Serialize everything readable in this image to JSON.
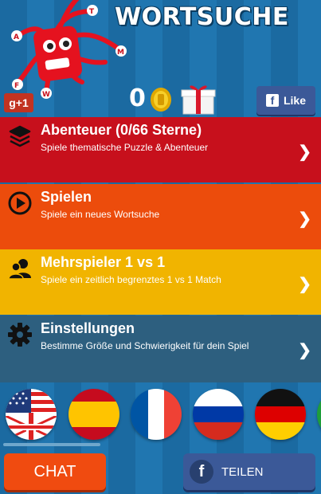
{
  "header": {
    "title": "WORTSUCHE",
    "gplus_label": "g+1",
    "coin_count": "0",
    "fb_like_label": "Like",
    "mascot_letters": [
      "T",
      "A",
      "M",
      "F",
      "W"
    ]
  },
  "menu": [
    {
      "title": "Abenteuer (0/66 Sterne)",
      "subtitle": "Spiele thematische Puzzle & Abenteuer",
      "icon": "layers-icon"
    },
    {
      "title": "Spielen",
      "subtitle": "Spiele ein neues Wortsuche",
      "icon": "play-icon"
    },
    {
      "title": "Mehrspieler 1 vs 1",
      "subtitle": "Spiele ein zeitlich begrenztes 1 vs 1 Match",
      "icon": "users-icon"
    },
    {
      "title": "Einstellungen",
      "subtitle": "Bestimme Größe und Schwierigkeit für dein Spiel",
      "icon": "gear-icon"
    }
  ],
  "languages": [
    "English",
    "Español",
    "Français",
    "Русский",
    "Deutsch"
  ],
  "footer": {
    "chat_label": "CHAT",
    "share_label": "TEILEN"
  },
  "colors": {
    "adventure": "#c7101c",
    "play": "#ec4c0c",
    "multiplayer": "#f1b400",
    "settings": "#2d5f7f",
    "facebook": "#3b5998"
  }
}
